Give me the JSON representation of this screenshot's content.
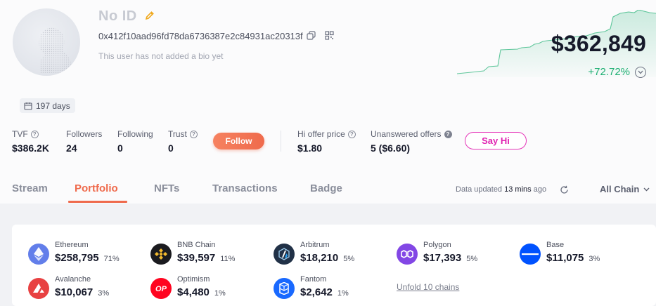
{
  "profile": {
    "name": "No ID",
    "address": "0x412f10aad96fd78da6736387e2c84931ac20313f",
    "bio": "This user has not added a bio yet",
    "days": "197 days"
  },
  "networth": {
    "value": "$362,849",
    "change": "+72.72%",
    "accent_color": "#20b074"
  },
  "stats": [
    {
      "label": "TVF",
      "value": "$386.2K",
      "help_icon": "question-circle-icon"
    },
    {
      "label": "Followers",
      "value": "24"
    },
    {
      "label": "Following",
      "value": "0"
    },
    {
      "label": "Trust",
      "value": "0",
      "help_icon": "question-circle-icon"
    },
    {
      "label": "Hi offer price",
      "value": "$1.80",
      "help_icon": "question-circle-icon"
    },
    {
      "label": "Unanswered offers",
      "value": "5 ($6.60)",
      "help_icon": "question-filled-icon"
    }
  ],
  "actions": {
    "follow_label": "Follow",
    "follow_color": "#ef6a4c",
    "sayhi_label": "Say Hi",
    "sayhi_color": "#e024b2"
  },
  "tabs": [
    {
      "label": "Stream",
      "active": false
    },
    {
      "label": "Portfolio",
      "active": true
    },
    {
      "label": "NFTs",
      "active": false
    },
    {
      "label": "Transactions",
      "active": false
    },
    {
      "label": "Badge",
      "active": false
    }
  ],
  "update": {
    "prefix": "Data updated",
    "time": "13 mins",
    "suffix": "ago",
    "chain_filter": "All Chain"
  },
  "chains": [
    {
      "name": "Ethereum",
      "value": "$258,795",
      "pct": "71%",
      "icon": "ethereum-icon",
      "color": "#627eea"
    },
    {
      "name": "BNB Chain",
      "value": "$39,597",
      "pct": "11%",
      "icon": "bnb-chain-icon",
      "color": "#1b1b1f"
    },
    {
      "name": "Arbitrum",
      "value": "$18,210",
      "pct": "5%",
      "icon": "arbitrum-icon",
      "color": "#213147"
    },
    {
      "name": "Polygon",
      "value": "$17,393",
      "pct": "5%",
      "icon": "polygon-icon",
      "color": "#8247e5"
    },
    {
      "name": "Base",
      "value": "$11,075",
      "pct": "3%",
      "icon": "base-icon",
      "color": "#0052ff"
    },
    {
      "name": "Avalanche",
      "value": "$10,067",
      "pct": "3%",
      "icon": "avalanche-icon",
      "color": "#e84142"
    },
    {
      "name": "Optimism",
      "value": "$4,480",
      "pct": "1%",
      "icon": "optimism-icon",
      "color": "#ff0420"
    },
    {
      "name": "Fantom",
      "value": "$2,642",
      "pct": "1%",
      "icon": "fantom-icon",
      "color": "#1969ff"
    }
  ],
  "unfold_label": "Unfold 10 chains"
}
